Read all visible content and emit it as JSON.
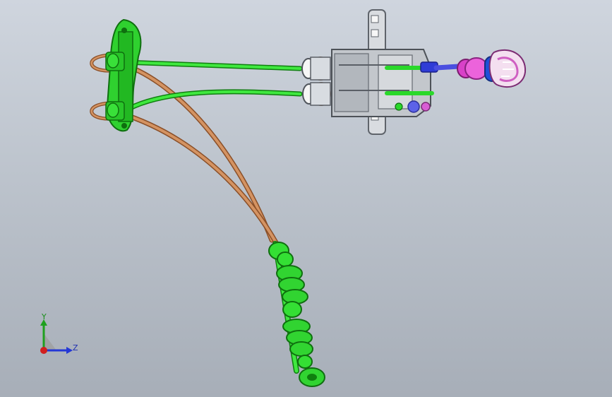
{
  "viewport": {
    "background_top": "#cfd5de",
    "background_bottom": "#a7aeb8"
  },
  "model": {
    "colors": {
      "green_part": "#2fd12f",
      "green_dark": "#0f7f0f",
      "cable_orange": "#c8844f",
      "housing_gray": "#c8ccd1",
      "housing_dark": "#6b7077",
      "knob_pink": "#e64fd6",
      "knob_light": "#f4dff0",
      "rod_blue": "#4a4fe0"
    },
    "icons": [
      "cable-bracket-icon",
      "cable-icon",
      "shifter-housing-icon",
      "shift-knob-icon",
      "bellows-icon"
    ]
  },
  "triad": {
    "y_label": "Y",
    "z_label": "Z",
    "colors": {
      "y_axis": "#1fa01f",
      "z_axis": "#2438d6",
      "x_axis": "#d11f1f"
    }
  }
}
